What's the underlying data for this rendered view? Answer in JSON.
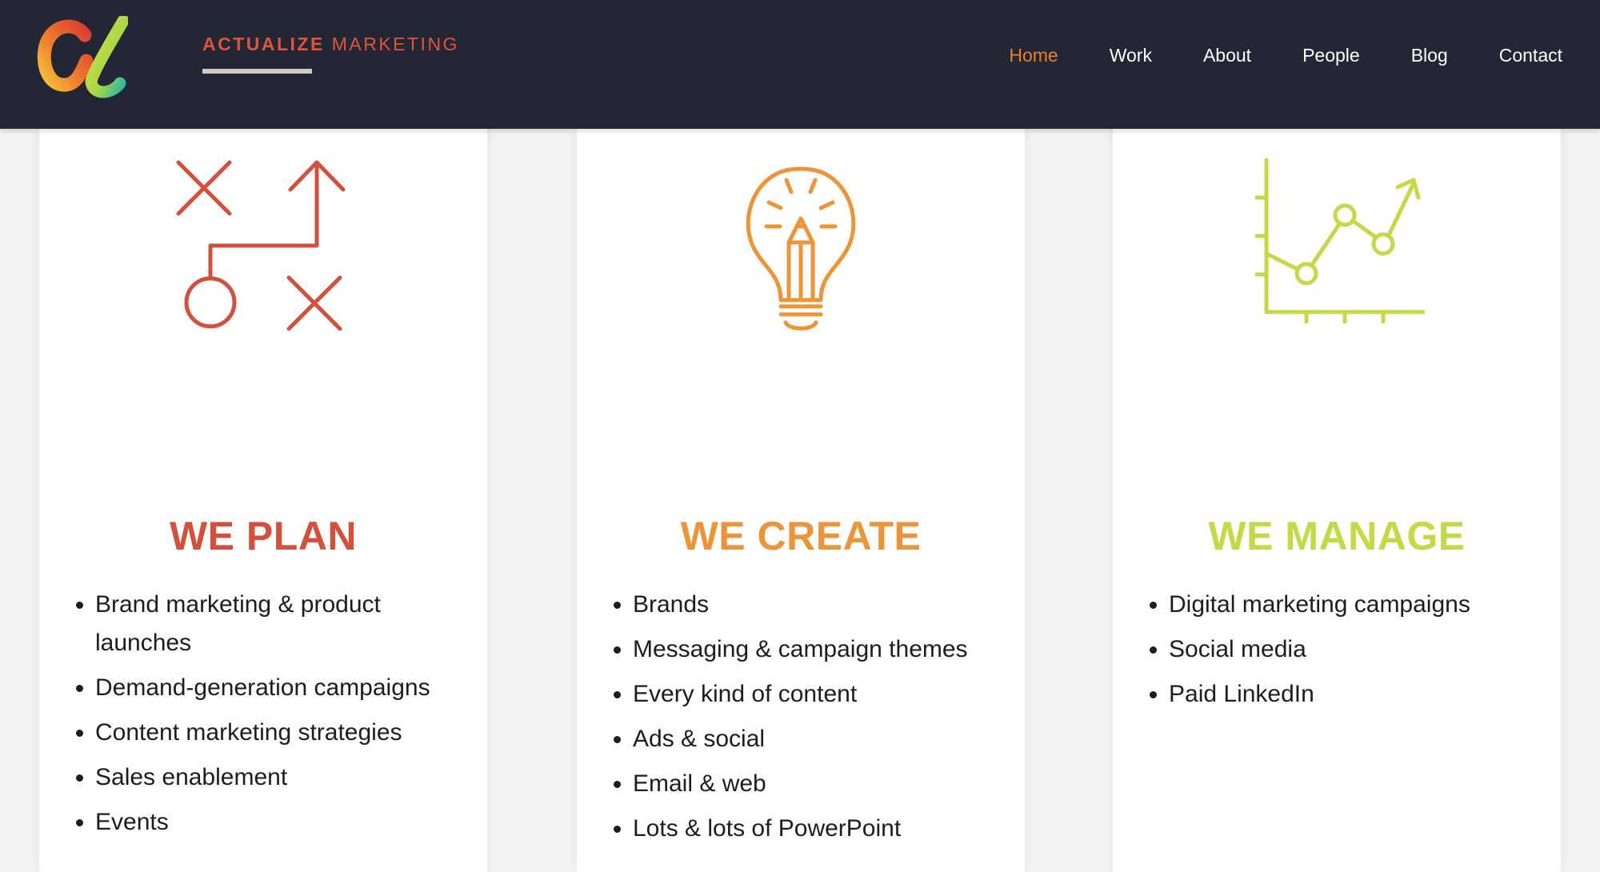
{
  "brand": {
    "name_bold": "ACTUALIZE",
    "name_light": "MARKETING"
  },
  "nav": {
    "items": [
      "Home",
      "Work",
      "About",
      "People",
      "Blog",
      "Contact"
    ],
    "active": "Home"
  },
  "colors": {
    "header_bg": "#232634",
    "plan": "#d2503c",
    "create": "#ee9438",
    "manage": "#c2da45",
    "active_nav": "#ee7d2c"
  },
  "cards": [
    {
      "icon": "strategy-plan-icon",
      "title_light": "WE",
      "title_bold": "PLAN",
      "items": [
        "Brand marketing & product launches",
        "Demand-generation campaigns",
        "Content marketing strategies",
        "Sales enablement",
        "Events"
      ]
    },
    {
      "icon": "lightbulb-pencil-icon",
      "title_light": "WE",
      "title_bold": "CREATE",
      "items": [
        "Brands",
        "Messaging & campaign themes",
        "Every kind of content",
        "Ads & social",
        "Email & web",
        "Lots & lots of PowerPoint"
      ]
    },
    {
      "icon": "growth-chart-icon",
      "title_light": "WE",
      "title_bold": "MANAGE",
      "items": [
        "Digital marketing campaigns",
        "Social media",
        "Paid LinkedIn"
      ]
    }
  ]
}
